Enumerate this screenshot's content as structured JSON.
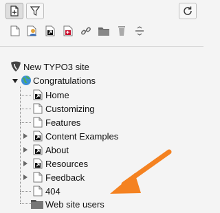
{
  "toolbar": {
    "new_page": "new-page-icon",
    "filter": "filter-icon",
    "refresh": "refresh-icon"
  },
  "doktype_icons": [
    "standard-page-icon",
    "backend-user-section-icon",
    "shortcut-icon",
    "mountpoint-icon",
    "link-icon",
    "folder-icon",
    "recycler-icon",
    "menu-separator-icon"
  ],
  "tree": {
    "root": {
      "label": "New TYPO3 site",
      "icon": "typo3-logo-icon"
    },
    "site": {
      "label": "Congratulations",
      "icon": "globe-icon",
      "expanded": true
    },
    "children": [
      {
        "label": "Home",
        "icon": "shortcut-page-icon",
        "expandable": false
      },
      {
        "label": "Customizing",
        "icon": "page-icon",
        "expandable": false
      },
      {
        "label": "Features",
        "icon": "page-icon",
        "expandable": false
      },
      {
        "label": "Content Examples",
        "icon": "shortcut-page-icon",
        "expandable": true
      },
      {
        "label": "About",
        "icon": "shortcut-page-icon",
        "expandable": true
      },
      {
        "label": "Resources",
        "icon": "shortcut-page-icon",
        "expandable": true
      },
      {
        "label": "Feedback",
        "icon": "page-icon",
        "expandable": true
      },
      {
        "label": "404",
        "icon": "page-icon",
        "expandable": false
      },
      {
        "label": "Web site users",
        "icon": "folder-icon",
        "expandable": false
      }
    ]
  },
  "annotation": {
    "arrow_color": "#f48221"
  }
}
